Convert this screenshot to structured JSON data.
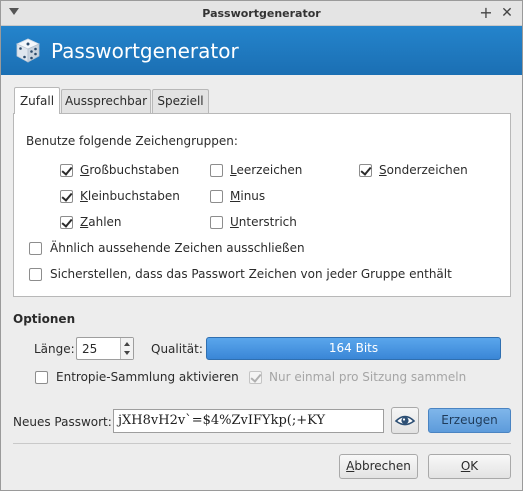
{
  "window": {
    "title": "Passwortgenerator"
  },
  "banner": {
    "title": "Passwortgenerator",
    "icon": "dice-icon"
  },
  "tabs": [
    {
      "label": "Zufall",
      "active": true
    },
    {
      "label": "Aussprechbar",
      "active": false
    },
    {
      "label": "Speziell",
      "active": false
    }
  ],
  "random": {
    "groups_label": "Benutze folgende Zeichengruppen:",
    "groups": {
      "uppercase": {
        "label": "Großbuchstaben",
        "checked": true
      },
      "lowercase": {
        "label": "Kleinbuchstaben",
        "checked": true
      },
      "digits": {
        "label": "Zahlen",
        "checked": true
      },
      "space": {
        "label": "Leerzeichen",
        "checked": false
      },
      "minus": {
        "label": "Minus",
        "checked": false
      },
      "underscore": {
        "label": "Unterstrich",
        "checked": false
      },
      "special": {
        "label": "Sonderzeichen",
        "checked": true
      }
    },
    "exclude_lookalike": {
      "label": "Ähnlich aussehende Zeichen ausschließen",
      "checked": false
    },
    "every_group": {
      "label": "Sicherstellen, dass das Passwort Zeichen von jeder Gruppe enthält",
      "checked": false
    }
  },
  "options": {
    "title": "Optionen",
    "length_label": "Länge:",
    "length_value": "25",
    "quality_label": "Qualität:",
    "quality_value": "164 Bits",
    "entropy": {
      "label": "Entropie-Sammlung aktivieren",
      "checked": false
    },
    "once_per_session": {
      "label": "Nur einmal pro Sitzung sammeln",
      "checked": true,
      "disabled": true
    }
  },
  "password": {
    "label": "Neues Passwort:",
    "value": "jXH8vH2v`=$4%ZvIFYkp(;+KY",
    "toggle_icon": "eye-icon",
    "generate_label": "Erzeugen"
  },
  "footer": {
    "cancel_label": "Abbrechen",
    "ok_label": "OK"
  },
  "colors": {
    "banner": "#1e7ac2",
    "quality_bar": "#4a96e0",
    "primary_button": "#6aa6e0"
  }
}
